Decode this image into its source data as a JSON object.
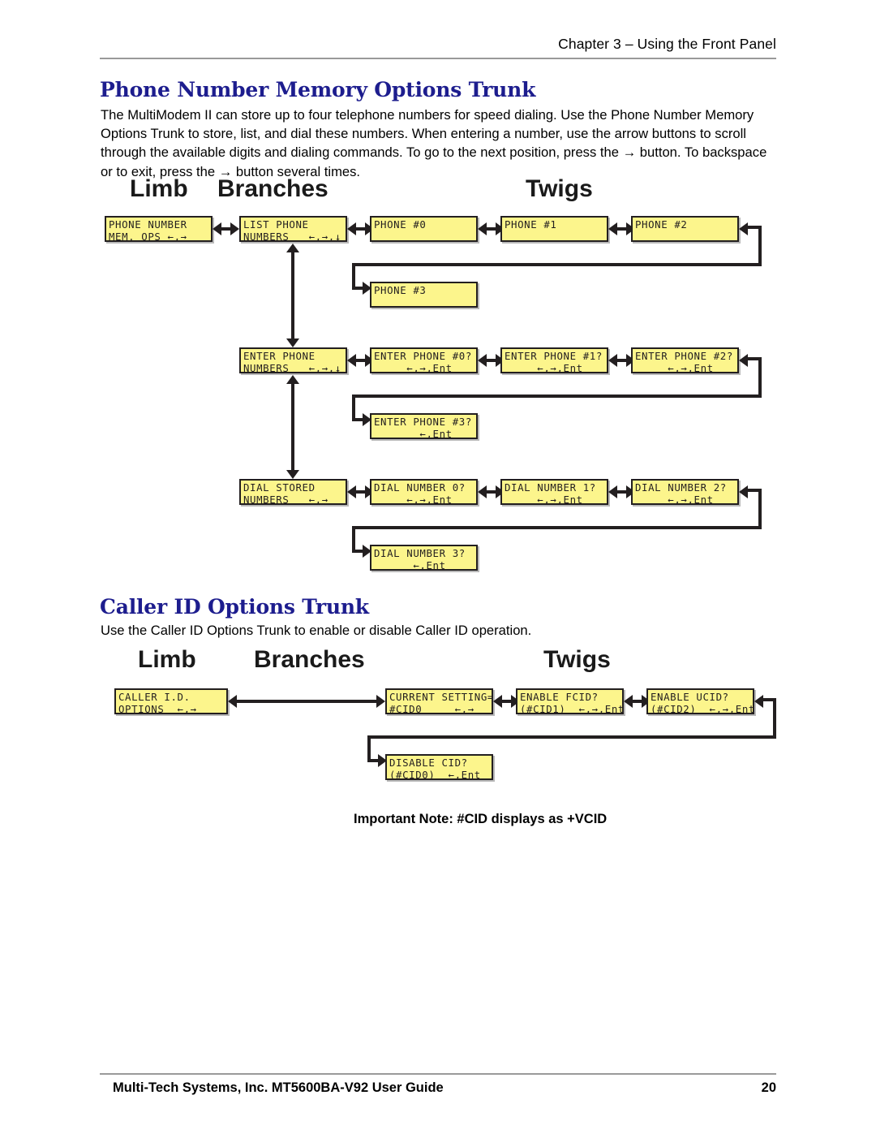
{
  "header": {
    "chapter": "Chapter 3 – Using the Front Panel"
  },
  "footer": {
    "left": "Multi-Tech Systems, Inc. MT5600BA-V92 User Guide",
    "page_number": "20"
  },
  "sections": [
    {
      "title": "Phone Number Memory Options Trunk",
      "body": "The MultiModem II can store up to four telephone numbers for speed dialing. Use the Phone Number Memory Options Trunk to store, list, and dial these numbers.  When entering a number, use the arrow buttons to scroll through the available digits and dialing commands. To go to the next position, press the → button. To backspace or to exit, press the → button several times."
    },
    {
      "title": "Caller ID Options Trunk",
      "body": "Use the Caller ID Options Trunk to enable or disable Caller ID operation."
    }
  ],
  "diagram1": {
    "columns": {
      "limb": "Limb",
      "branches": "Branches",
      "twigs": "Twigs"
    },
    "boxes": {
      "limb": {
        "line1": "PHONE NUMBER",
        "line2": "MEM. OPS ←,→"
      },
      "list_branch": {
        "line1": "LIST PHONE",
        "line2": "NUMBERS   ←,→,↓"
      },
      "phone0": {
        "line1": "PHONE #0",
        "line2": ""
      },
      "phone1": {
        "line1": "PHONE #1",
        "line2": ""
      },
      "phone2": {
        "line1": "PHONE #2",
        "line2": ""
      },
      "phone3": {
        "line1": "PHONE #3",
        "line2": ""
      },
      "enter_branch": {
        "line1": "ENTER PHONE",
        "line2": "NUMBERS   ←,→,↓"
      },
      "enter0": {
        "line1": "ENTER PHONE #0?",
        "line2": "     ←,→,Ent"
      },
      "enter1": {
        "line1": "ENTER PHONE #1?",
        "line2": "     ←,→,Ent"
      },
      "enter2": {
        "line1": "ENTER PHONE #2?",
        "line2": "     ←,→,Ent"
      },
      "enter3": {
        "line1": "ENTER PHONE #3?",
        "line2": "       ←,Ent"
      },
      "dial_branch": {
        "line1": "DIAL STORED",
        "line2": "NUMBERS   ←,→"
      },
      "dial0": {
        "line1": "DIAL NUMBER 0?",
        "line2": "     ←,→,Ent"
      },
      "dial1": {
        "line1": "DIAL NUMBER 1?",
        "line2": "     ←,→,Ent"
      },
      "dial2": {
        "line1": "DIAL NUMBER 2?",
        "line2": "     ←,→,Ent"
      },
      "dial3": {
        "line1": "DIAL NUMBER 3?",
        "line2": "      ←,Ent"
      }
    }
  },
  "diagram2": {
    "columns": {
      "limb": "Limb",
      "branches": "Branches",
      "twigs": "Twigs"
    },
    "boxes": {
      "limb": {
        "line1": "CALLER I.D.",
        "line2": "OPTIONS  ←,→"
      },
      "current": {
        "line1": "CURRENT SETTING=",
        "line2": "#CID0     ←,→"
      },
      "fcid": {
        "line1": "ENABLE FCID?",
        "line2": "(#CID1)  ←,→,Ent"
      },
      "ucid": {
        "line1": "ENABLE UCID?",
        "line2": "(#CID2)  ←,→,Ent"
      },
      "disable": {
        "line1": "DISABLE CID?",
        "line2": "(#CID0)  ←,Ent"
      }
    },
    "note": "Important Note: #CID displays as +VCID"
  }
}
